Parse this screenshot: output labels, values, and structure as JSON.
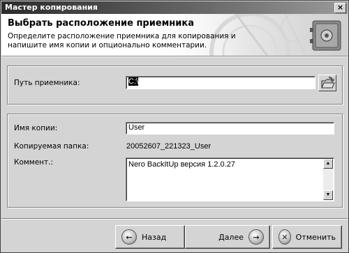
{
  "window": {
    "title": "Мастер копирования",
    "close": "×"
  },
  "header": {
    "title": "Выбрать расположение приемника",
    "description": "Определите расположение приемника для копирования и напишите имя копии и опционально комментарии."
  },
  "destination": {
    "label": "Путь приемника:",
    "value": "C:\\"
  },
  "copy": {
    "name_label": "Имя копии:",
    "name_value": "User",
    "folder_label": "Копируемая папка:",
    "folder_value": "20052607_221323_User",
    "comment_label": "Коммент.:",
    "comment_value": "Nero BackItUp версия 1.2.0.27"
  },
  "buttons": {
    "back": "Назад",
    "next": "Далее",
    "cancel": "Отменить"
  },
  "icons": {
    "back": "arrow-left-icon",
    "next": "arrow-right-icon",
    "cancel": "cancel-circle-icon",
    "folder": "folder-browse-icon",
    "header": "safe-icon"
  }
}
